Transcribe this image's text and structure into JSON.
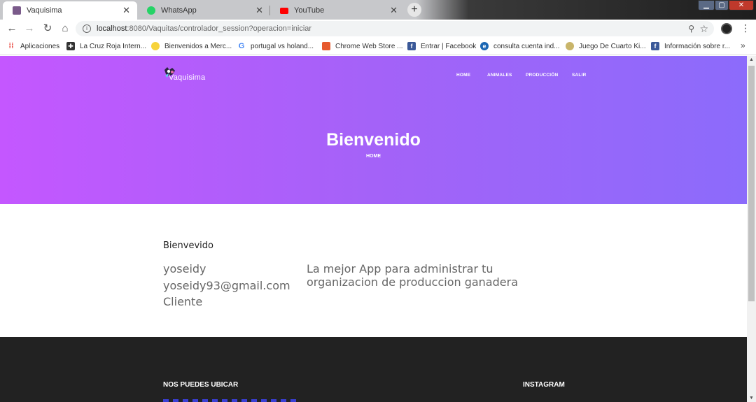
{
  "browser": {
    "tabs": [
      {
        "title": "Vaquisima",
        "active": true,
        "favicon_color": "#7a5a8a"
      },
      {
        "title": "WhatsApp",
        "active": false,
        "favicon_color": "#25d366"
      },
      {
        "title": "YouTube",
        "active": false,
        "favicon_color": "#ff0000"
      }
    ],
    "new_tab_label": "+",
    "url_host": "localhost",
    "url_rest": ":8080/Vaquitas/controlador_session?operacion=iniciar",
    "bookmarks": [
      {
        "label": "Aplicaciones",
        "icon": "apps-grid-icon",
        "color": "#e8453c"
      },
      {
        "label": "La Cruz Roja Intern...",
        "icon": "red-cross-icon",
        "color": "#333333"
      },
      {
        "label": "Bienvenidos a Merc...",
        "icon": "mercadolibre-icon",
        "color": "#f7d33b"
      },
      {
        "label": "portugal vs holand...",
        "icon": "google-icon",
        "color": "#4285f4"
      },
      {
        "label": "Chrome Web Store ...",
        "icon": "chrome-store-icon",
        "color": "#e65a2e"
      },
      {
        "label": "Entrar | Facebook",
        "icon": "facebook-icon",
        "color": "#3b5998"
      },
      {
        "label": "consulta cuenta ind...",
        "icon": "bank-icon",
        "color": "#1a66b3"
      },
      {
        "label": "Juego De Cuarto Ki...",
        "icon": "game-icon",
        "color": "#c9b56a"
      },
      {
        "label": "Información sobre r...",
        "icon": "facebook-icon",
        "color": "#3b5998"
      }
    ],
    "bookmarks_more": "»"
  },
  "site": {
    "logo_text": "Vaquisima",
    "nav": [
      {
        "label": "HOME"
      },
      {
        "label": "ANIMALES"
      },
      {
        "label": "PRODUCCIÓN"
      },
      {
        "label": "SALIR"
      }
    ],
    "hero_title": "Bienvenido",
    "hero_breadcrumb": "HOME",
    "welcome_heading": "Bienvevido",
    "user": {
      "name": "yoseidy",
      "email": "yoseidy93@gmail.com",
      "role": "Cliente"
    },
    "tagline": "La mejor App para administrar tu organizacion de produccion ganadera",
    "footer": {
      "left_heading": "NOS PUEDES UBICAR",
      "right_heading": "INSTAGRAM"
    },
    "colors": {
      "hero_start": "#c457ff",
      "hero_end": "#8c6bfb",
      "footer_bg": "#222222"
    }
  }
}
